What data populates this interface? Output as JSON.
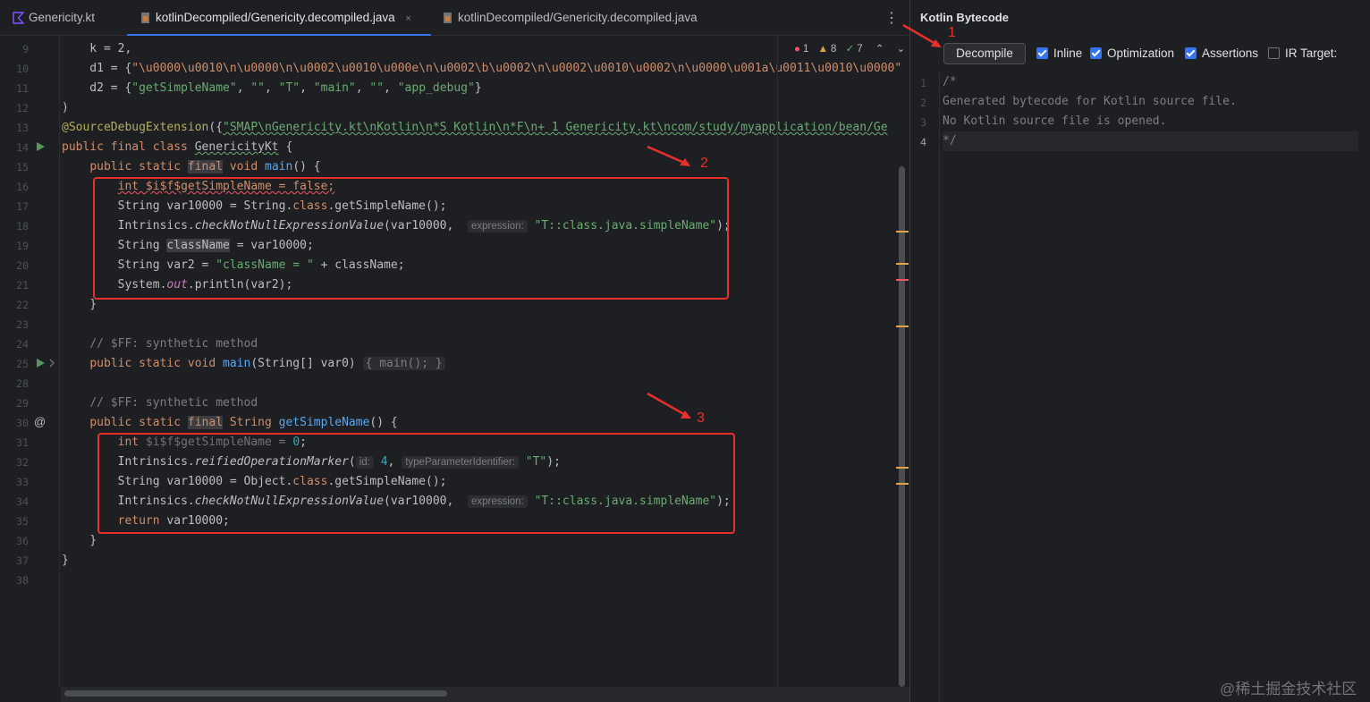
{
  "tabs": [
    {
      "label": "Genericity.kt",
      "active": false,
      "closable": false
    },
    {
      "label": "kotlinDecompiled/Genericity.decompiled.java",
      "active": true,
      "closable": true,
      "close": "×"
    },
    {
      "label": "kotlinDecompiled/Genericity.decompiled.java",
      "active": false,
      "closable": false
    }
  ],
  "tab_more": "⋮",
  "inspection": {
    "errors": "1",
    "warnings": "8",
    "weak_warnings": "7",
    "up": "⌃",
    "down": "⌄"
  },
  "line_numbers": [
    "9",
    "10",
    "11",
    "12",
    "13",
    "14",
    "15",
    "16",
    "17",
    "18",
    "19",
    "20",
    "21",
    "22",
    "23",
    "24",
    "25",
    "28",
    "29",
    "30",
    "31",
    "32",
    "33",
    "34",
    "35",
    "36",
    "37",
    "38"
  ],
  "hints": {
    "expression": "expression:",
    "id": "id:",
    "type_param": "typeParameterIdentifier:"
  },
  "code": {
    "l9": "    k = 2,",
    "l10_a": "    d1 = {",
    "l10_s": "\"\\u0000\\u0010\\n\\u0000\\n\\u0002\\u0010\\u000e\\n\\u0002\\b\\u0002\\n\\u0002\\u0010\\u0002\\n\\u0000\\u001a\\u0011\\u0010\\u0000\"",
    "l11_a": "    d2 = {",
    "l11_s1": "\"getSimpleName\"",
    "l11_s2": "\"\"",
    "l11_s3": "\"T\"",
    "l11_s4": "\"main\"",
    "l11_s5": "\"\"",
    "l11_s6": "\"app_debug\"",
    "l11_end": "}",
    "l12": ")",
    "l13_ann": "@SourceDebugExtension",
    "l13_open": "({",
    "l13_str": "\"SMAP\\nGenericity.kt\\nKotlin\\n*S Kotlin\\n*F\\n+ 1 Genericity.kt\\ncom/study/myapplication/bean/Ge",
    "l14_kw": "public final class ",
    "l14_name": "GenericityKt",
    "l14_end": " {",
    "l15_kw1": "public static ",
    "l15_final": "final",
    "l15_kw2": " void ",
    "l15_fn": "main",
    "l15_end": "() {",
    "l16": "int $i$f$getSimpleName = false;",
    "l17_a": "String var10000 = String.",
    "l17_kw": "class",
    "l17_b": ".getSimpleName();",
    "l18_a": "Intrinsics.",
    "l18_fn": "checkNotNullExpressionValue",
    "l18_b": "(var10000, ",
    "l18_str": "\"T::class.java.simpleName\"",
    "l18_end": ");",
    "l19_a": "String ",
    "l19_var": "className",
    "l19_b": " = var10000;",
    "l20_a": "String var2 = ",
    "l20_str": "\"className = \"",
    "l20_b": " + className;",
    "l21_a": "System.",
    "l21_fld": "out",
    "l21_b": ".println(var2);",
    "l22": "    }",
    "l24": "// $FF: synthetic method",
    "l25_kw": "public static void ",
    "l25_fn": "main",
    "l25_b": "(String[] var0)",
    "l25_fold": "{ main(); }",
    "l29": "// $FF: synthetic method",
    "l30_kw1": "public static ",
    "l30_final": "final",
    "l30_kw2": " String ",
    "l30_fn": "getSimpleName",
    "l30_end": "() {",
    "l31_kw": "int ",
    "l31_a": "$i$f$getSimpleName = ",
    "l31_num": "0",
    "l31_end": ";",
    "l32_a": "Intrinsics.",
    "l32_fn": "reifiedOperationMarker",
    "l32_b": "(",
    "l32_num": "4",
    "l32_c": ", ",
    "l32_str": "\"T\"",
    "l32_end": ");",
    "l33_a": "String var10000 = Object.",
    "l33_kw": "class",
    "l33_b": ".getSimpleName();",
    "l34_a": "Intrinsics.",
    "l34_fn": "checkNotNullExpressionValue",
    "l34_b": "(var10000, ",
    "l34_str": "\"T::class.java.simpleName\"",
    "l34_end": ");",
    "l35_kw": "return",
    "l35_b": " var10000;",
    "l36": "    }",
    "l37": "}"
  },
  "annotations": [
    "1",
    "2",
    "3"
  ],
  "panel": {
    "title": "Kotlin Bytecode",
    "decompile": "Decompile",
    "options": [
      {
        "label": "Inline",
        "checked": true
      },
      {
        "label": "Optimization",
        "checked": true
      },
      {
        "label": "Assertions",
        "checked": true
      },
      {
        "label": "IR Target:",
        "checked": false
      }
    ],
    "line_numbers": [
      "1",
      "2",
      "3",
      "4"
    ],
    "lines": [
      "/*",
      "Generated bytecode for Kotlin source file.",
      "No Kotlin source file is opened.",
      "*/"
    ]
  },
  "watermark": "@稀土掘金技术社区",
  "colors": {
    "accent": "#3574f0",
    "annotation_red": "#e8302a",
    "keyword": "#cf8e6d",
    "string": "#6aab73",
    "function": "#56a8f5"
  }
}
